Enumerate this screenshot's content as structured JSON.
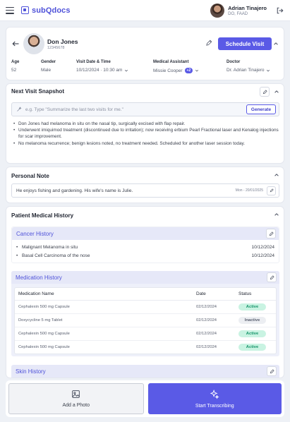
{
  "app": {
    "name": "subQdocs"
  },
  "user": {
    "name": "Adrian Tinajero",
    "role": "DO, FAAD"
  },
  "patient": {
    "name": "Don Jones",
    "id": "12345678",
    "schedule_label": "Schedule Visit",
    "fields": [
      {
        "label": "Age",
        "value": "52"
      },
      {
        "label": "Gender",
        "value": "Male"
      },
      {
        "label": "Visit Date & Time",
        "value": "10/12/2024 · 10:30 am"
      },
      {
        "label": "Medical Assistant",
        "value": "Missie Cooper",
        "badge": "+2"
      },
      {
        "label": "Doctor",
        "value": "Dr. Adrian Tinajero"
      }
    ]
  },
  "snapshot": {
    "title": "Next Visit Snapshot",
    "placeholder": "e.g. Type \"Summarize the last two visits for me.\"",
    "generate_label": "Generate",
    "bullets": [
      "Don Jones had melanoma in situ on the nasal tip, surgically excised with flap repair.",
      "Underwent imiquimod treatment (discontinued due to irritation); now receiving erbium Pearl Fractional laser and Kenalog injections for scar improvement.",
      "No melanoma recurrence; benign lesions noted, no treatment needed. Scheduled for another laser session today."
    ]
  },
  "personal_note": {
    "title": "Personal Note",
    "text": "He enjoys fishing and gardening. His wife's name is Julie.",
    "date": "Mon - 20/01/2025"
  },
  "history": {
    "title": "Patient Medical History",
    "cancer": {
      "title": "Cancer History",
      "items": [
        {
          "name": "Malignant Melanoma in situ",
          "date": "10/12/2024"
        },
        {
          "name": "Basal Cell Carcinoma of the nose",
          "date": "10/12/2024"
        }
      ]
    },
    "medication": {
      "title": "Medication History",
      "headers": {
        "name": "Medication Name",
        "date": "Date",
        "status": "Status"
      },
      "rows": [
        {
          "name": "Cephalexin 500 mg Capsule",
          "date": "02/12/2024",
          "status": "Active"
        },
        {
          "name": "Doxycycline 5 mg Tablet",
          "date": "02/12/2024",
          "status": "Inactive"
        },
        {
          "name": "Cephalexin 500 mg Capsule",
          "date": "02/12/2024",
          "status": "Active"
        },
        {
          "name": "Cephalexin 500 mg Capsule",
          "date": "02/12/2024",
          "status": "Active"
        }
      ]
    },
    "skin": {
      "title": "Skin History"
    }
  },
  "actions": {
    "add_photo": "Add a Photo",
    "transcribe": "Start Transcribing"
  },
  "colors": {
    "accent": "#5a5ae6",
    "active": "#16946a",
    "section_bg": "#e6e8f8"
  },
  "icons": [
    "menu-icon",
    "logout-icon",
    "back-arrow-icon",
    "pencil-icon",
    "chevron-up-icon",
    "chevron-down-icon",
    "sparkle-icon",
    "image-icon"
  ]
}
